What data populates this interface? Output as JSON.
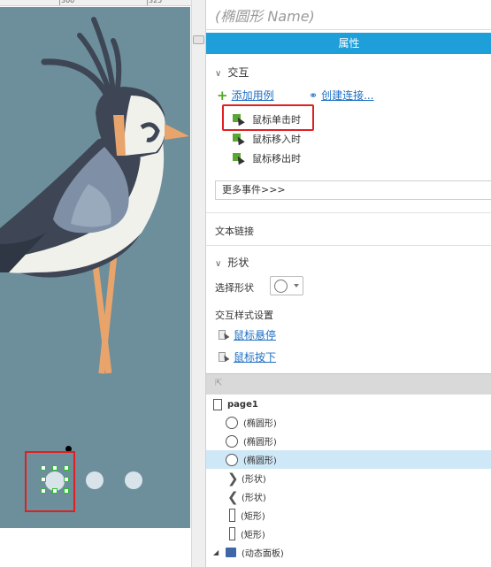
{
  "ruler": {
    "marks": [
      "300",
      "325"
    ]
  },
  "panel": {
    "title": "(椭圆形 Name)",
    "header": "属性"
  },
  "interaction": {
    "section_title": "交互",
    "add_case": "添加用例",
    "create_link": "创建连接...",
    "events": [
      "鼠标单击时",
      "鼠标移入时",
      "鼠标移出时"
    ],
    "more_events": "更多事件>>>"
  },
  "text_link": {
    "label": "文本链接"
  },
  "shape": {
    "section_title": "形状",
    "select_label": "选择形状",
    "selected_shape": "circle-icon"
  },
  "interaction_style": {
    "label": "交互样式设置",
    "hover": "鼠标悬停",
    "mousedown": "鼠标按下"
  },
  "outline": {
    "page": "page1",
    "items": [
      {
        "label": "(椭圆形)",
        "icon": "circle-icon"
      },
      {
        "label": "(椭圆形)",
        "icon": "circle-icon"
      },
      {
        "label": "(椭圆形)",
        "icon": "circle-icon"
      },
      {
        "label": "(形状)",
        "icon": "chevron-right-icon"
      },
      {
        "label": "(形状)",
        "icon": "chevron-left-icon"
      },
      {
        "label": "(矩形)",
        "icon": "rectangle-icon"
      },
      {
        "label": "(矩形)",
        "icon": "rectangle-icon"
      },
      {
        "label": "(动态面板)",
        "icon": "dynamic-panel-icon"
      }
    ],
    "selected_index": 2
  },
  "colors": {
    "header_blue": "#1e9fd9",
    "artboard": "#6c8f9b",
    "highlight_red": "#e02020",
    "selection_green": "#26c02a",
    "selected_row": "#cfe8f7",
    "link_blue": "#1d6fc4"
  }
}
